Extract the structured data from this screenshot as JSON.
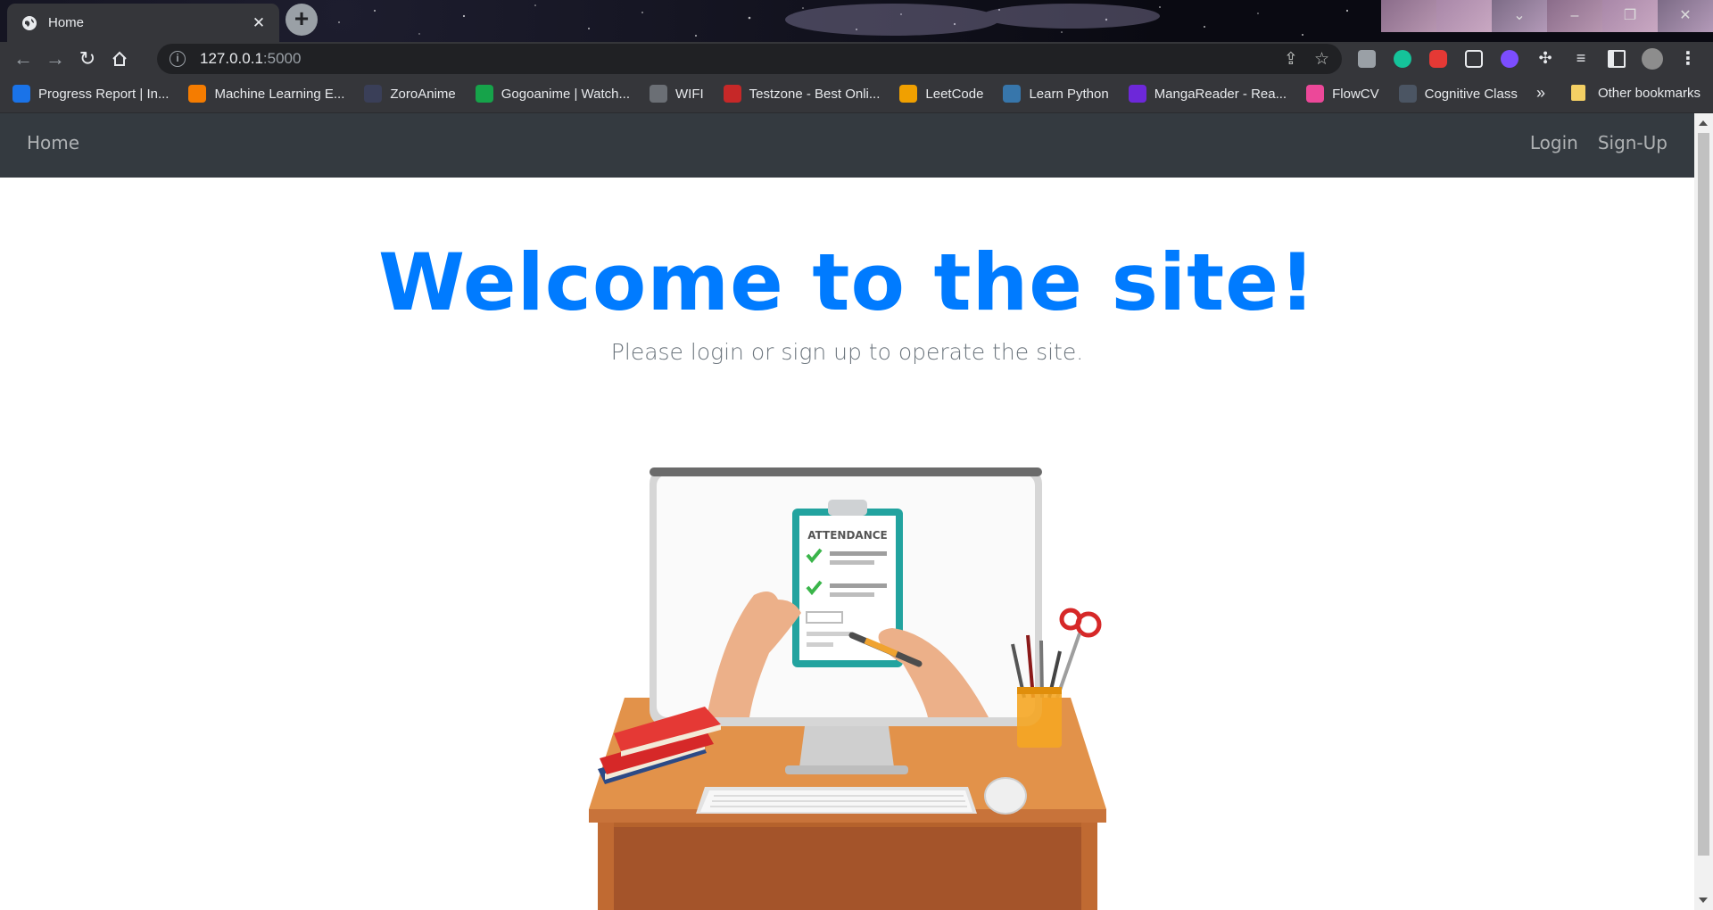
{
  "browser": {
    "tab_title": "Home",
    "url_host": "127.0.0.1",
    "url_port": ":5000",
    "bookmarks": [
      {
        "label": "Progress Report | In...",
        "icon": "is-icon",
        "color": "#1a73e8"
      },
      {
        "label": "Machine Learning E...",
        "icon": "hexagon-icon",
        "color": "#f57c00"
      },
      {
        "label": "ZoroAnime",
        "icon": "zoro-icon",
        "color": "#3a3f58"
      },
      {
        "label": "Gogoanime | Watch...",
        "icon": "tv-icon",
        "color": "#16a34a"
      },
      {
        "label": "WIFI",
        "icon": "globe-icon",
        "color": "#6b6f75"
      },
      {
        "label": "Testzone - Best Onli...",
        "icon": "bug-icon",
        "color": "#c62828"
      },
      {
        "label": "LeetCode",
        "icon": "leetcode-icon",
        "color": "#f0a000"
      },
      {
        "label": "Learn Python",
        "icon": "python-icon",
        "color": "#3776ab"
      },
      {
        "label": "MangaReader - Rea...",
        "icon": "manga-icon",
        "color": "#6d28d9"
      },
      {
        "label": "FlowCV",
        "icon": "flowcv-icon",
        "color": "#ec4899"
      },
      {
        "label": "Cognitive Class",
        "icon": "cognitive-icon",
        "color": "#4b5563"
      }
    ],
    "more_bookmarks": "»",
    "other_bookmarks": "Other bookmarks"
  },
  "navbar": {
    "home": "Home",
    "login": "Login",
    "signup": "Sign-Up"
  },
  "hero": {
    "title": "Welcome to the site!",
    "subtitle": "Please login or sign up to operate the site.",
    "illustration_text": "ATTENDANCE"
  },
  "colors": {
    "primary": "#007bff",
    "navbar_bg": "#343a40",
    "muted": "#6c757d"
  }
}
